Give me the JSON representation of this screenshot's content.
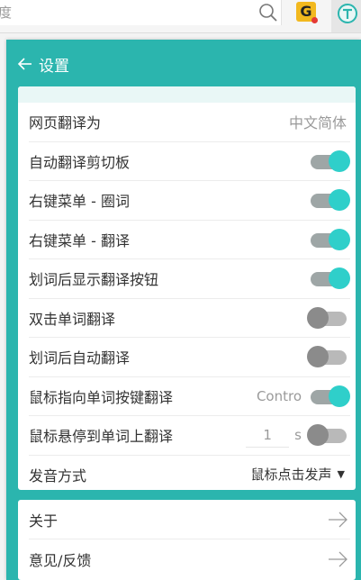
{
  "browser": {
    "address_text": "度",
    "icons": [
      "search-icon",
      "g-extension-icon",
      "translate-extension-icon"
    ],
    "ext_g_label": "G"
  },
  "popup": {
    "header": {
      "title": "设置"
    },
    "settings": {
      "page_translate_to": {
        "label": "网页翻译为",
        "value": "中文简体"
      },
      "auto_clipboard": {
        "label": "自动翻译剪切板",
        "on": true
      },
      "context_menu_select": {
        "label": "右键菜单 - 圈词",
        "on": true
      },
      "context_menu_translate": {
        "label": "右键菜单 - 翻译",
        "on": true
      },
      "show_translate_button": {
        "label": "划词后显示翻译按钮",
        "on": true
      },
      "double_click_translate": {
        "label": "双击单词翻译",
        "on": false
      },
      "auto_translate_after_select": {
        "label": "划词后自动翻译",
        "on": false
      },
      "mouse_point_key_translate": {
        "label": "鼠标指向单词按键翻译",
        "key": "Contro",
        "on": true
      },
      "hover_translate": {
        "label": "鼠标悬停到单词上翻译",
        "seconds": "1",
        "unit": "s",
        "on": false
      },
      "pronunciation": {
        "label": "发音方式",
        "value": "鼠标点击发声"
      }
    },
    "links": [
      {
        "label": "关于"
      },
      {
        "label": "意见/反馈"
      }
    ],
    "colors": {
      "accent": "#2bb5ae",
      "toggle_on": "#2fcfca",
      "toggle_off": "#8b8b8b"
    }
  }
}
